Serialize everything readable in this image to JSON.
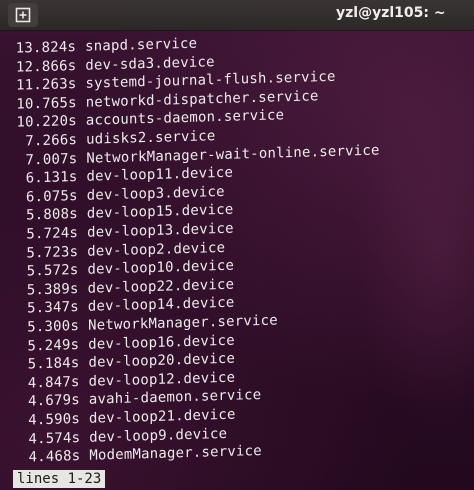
{
  "window": {
    "title": "yzl@yzl105: ~",
    "new_tab_icon": "new-tab-icon"
  },
  "lines": [
    {
      "time": "13.824s",
      "unit": "snapd.service"
    },
    {
      "time": "12.866s",
      "unit": "dev-sda3.device"
    },
    {
      "time": "11.263s",
      "unit": "systemd-journal-flush.service"
    },
    {
      "time": "10.765s",
      "unit": "networkd-dispatcher.service"
    },
    {
      "time": "10.220s",
      "unit": "accounts-daemon.service"
    },
    {
      "time": "7.266s",
      "unit": "udisks2.service"
    },
    {
      "time": "7.007s",
      "unit": "NetworkManager-wait-online.service"
    },
    {
      "time": "6.131s",
      "unit": "dev-loop11.device"
    },
    {
      "time": "6.075s",
      "unit": "dev-loop3.device"
    },
    {
      "time": "5.808s",
      "unit": "dev-loop15.device"
    },
    {
      "time": "5.724s",
      "unit": "dev-loop13.device"
    },
    {
      "time": "5.723s",
      "unit": "dev-loop2.device"
    },
    {
      "time": "5.572s",
      "unit": "dev-loop10.device"
    },
    {
      "time": "5.389s",
      "unit": "dev-loop22.device"
    },
    {
      "time": "5.347s",
      "unit": "dev-loop14.device"
    },
    {
      "time": "5.300s",
      "unit": "NetworkManager.service"
    },
    {
      "time": "5.249s",
      "unit": "dev-loop16.device"
    },
    {
      "time": "5.184s",
      "unit": "dev-loop20.device"
    },
    {
      "time": "4.847s",
      "unit": "dev-loop12.device"
    },
    {
      "time": "4.679s",
      "unit": "avahi-daemon.service"
    },
    {
      "time": "4.590s",
      "unit": "dev-loop21.device"
    },
    {
      "time": "4.574s",
      "unit": "dev-loop9.device"
    },
    {
      "time": "4.468s",
      "unit": "ModemManager.service"
    }
  ],
  "pager": {
    "status": "lines 1-23"
  }
}
